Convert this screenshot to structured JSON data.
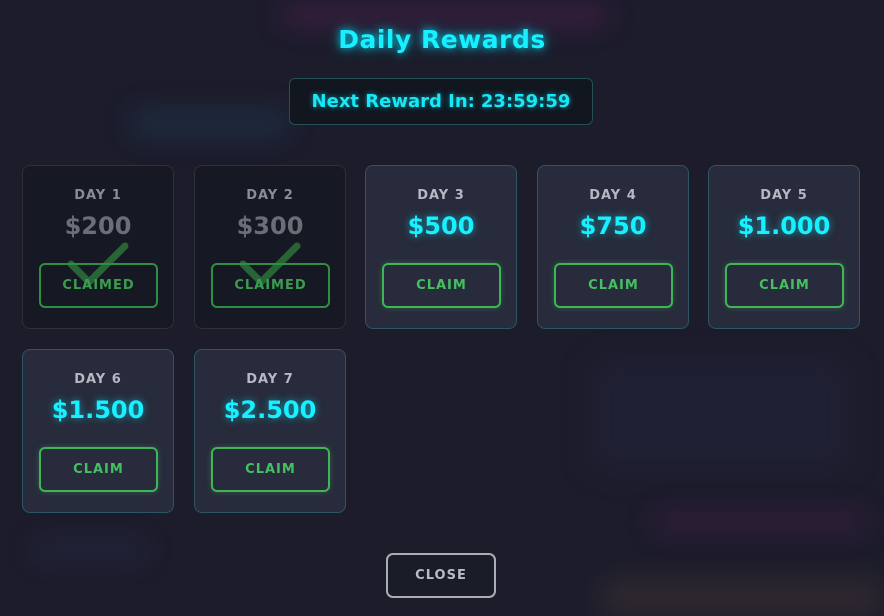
{
  "title": "Daily Rewards",
  "timer": {
    "label": "Next Reward In:",
    "value": "23:59:59"
  },
  "rewards": [
    {
      "day": "DAY 1",
      "amount": "$200",
      "status": "CLAIMED",
      "claimed": true
    },
    {
      "day": "DAY 2",
      "amount": "$300",
      "status": "CLAIMED",
      "claimed": true
    },
    {
      "day": "DAY 3",
      "amount": "$500",
      "status": "CLAIM",
      "claimed": false
    },
    {
      "day": "DAY 4",
      "amount": "$750",
      "status": "CLAIM",
      "claimed": false
    },
    {
      "day": "DAY 5",
      "amount": "$1.000",
      "status": "CLAIM",
      "claimed": false
    },
    {
      "day": "DAY 6",
      "amount": "$1.500",
      "status": "CLAIM",
      "claimed": false
    },
    {
      "day": "DAY 7",
      "amount": "$2.500",
      "status": "CLAIM",
      "claimed": false
    }
  ],
  "close_label": "CLOSE",
  "colors": {
    "accent": "#17f0ff",
    "claim_green": "#3fb556",
    "background": "#1c1c2b"
  },
  "icons": {
    "claimed_marker": "checkmark-icon"
  }
}
